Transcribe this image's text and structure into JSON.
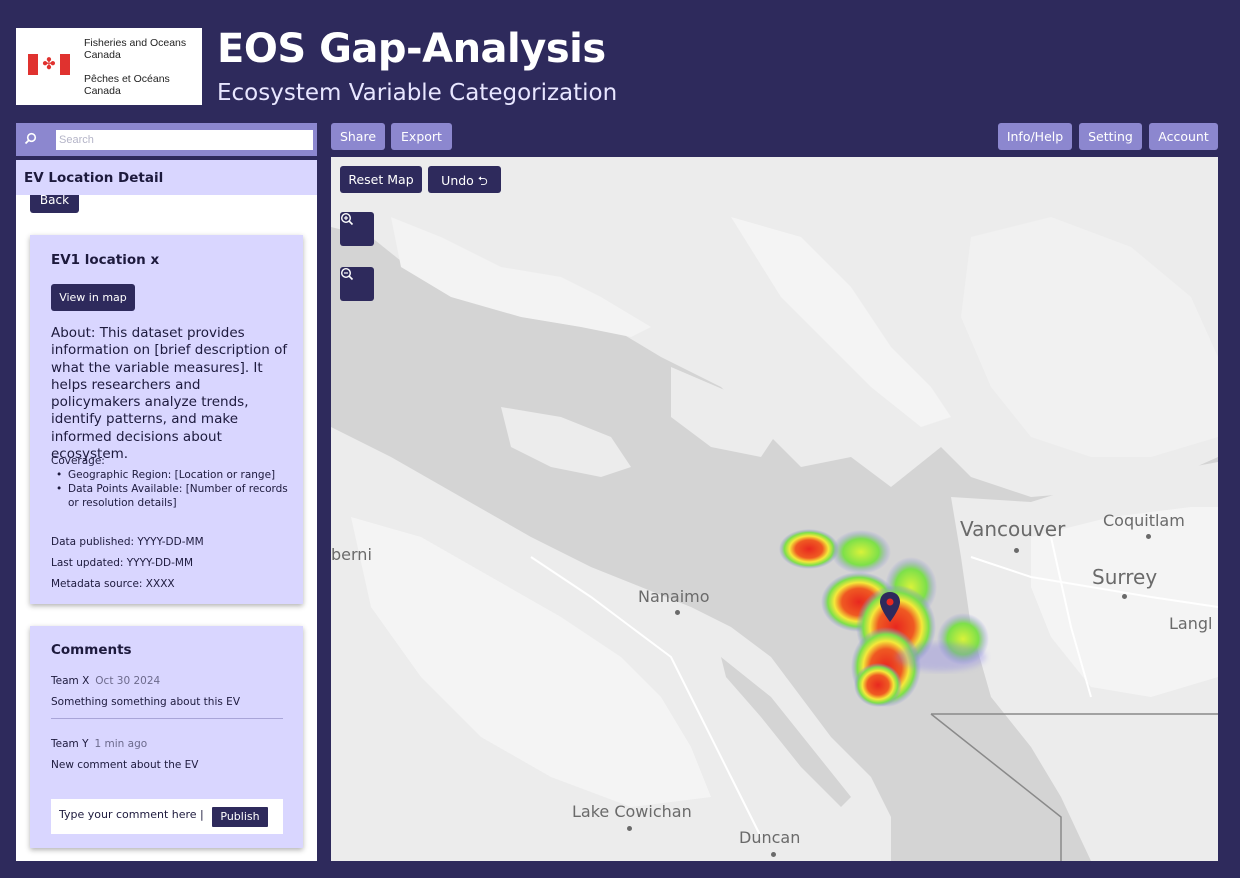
{
  "logo": {
    "en_line1": "Fisheries and Oceans",
    "en_line2": "Canada",
    "fr_line1": "Pêches et Océans",
    "fr_line2": "Canada"
  },
  "header": {
    "title": "EOS Gap-Analysis",
    "subtitle": "Ecosystem Variable Categorization"
  },
  "search": {
    "placeholder": "Search"
  },
  "toolbar": {
    "share": "Share",
    "export": "Export",
    "info_help": "Info/Help",
    "setting": "Setting",
    "account": "Account"
  },
  "sidebar": {
    "panel_title": "EV Location Detail",
    "back_label": "Back",
    "ev_card": {
      "title": "EV1 location x",
      "view_in_map": "View in map",
      "about": "About: This dataset provides information on [brief description of what the variable measures]. It helps researchers and policymakers analyze trends, identify patterns, and make informed decisions about ecosystem.",
      "coverage_label": "Coverage:",
      "coverage_items": [
        "Geographic Region: [Location or range]",
        "Data Points Available: [Number of records or resolution details]"
      ],
      "published": "Data published: YYYY-DD-MM",
      "updated": "Last updated: YYYY-DD-MM",
      "source": "Metadata source: XXXX"
    },
    "comments": {
      "title": "Comments",
      "items": [
        {
          "author": "Team X",
          "time": "Oct 30 2024",
          "text": "Something something about this EV"
        },
        {
          "author": "Team Y",
          "time": "1 min ago",
          "text": "New comment about the EV"
        }
      ],
      "input_placeholder": "Type your comment here |",
      "publish": "Publish"
    }
  },
  "map": {
    "reset": "Reset Map",
    "undo": "Undo ⮌",
    "places": {
      "vancouver": "Vancouver",
      "coquitlam": "Coquitlam",
      "surrey": "Surrey",
      "langley": "Langl",
      "nanaimo": "Nanaimo",
      "lake_cowichan": "Lake Cowichan",
      "duncan": "Duncan",
      "port_alberni": "berni"
    },
    "colors": {
      "heat_high": "#e8281f",
      "heat_mid": "#f5e83a",
      "heat_low": "#7de04a",
      "heat_edge": "#8b84e8",
      "marker": "#2e2a5c"
    }
  }
}
